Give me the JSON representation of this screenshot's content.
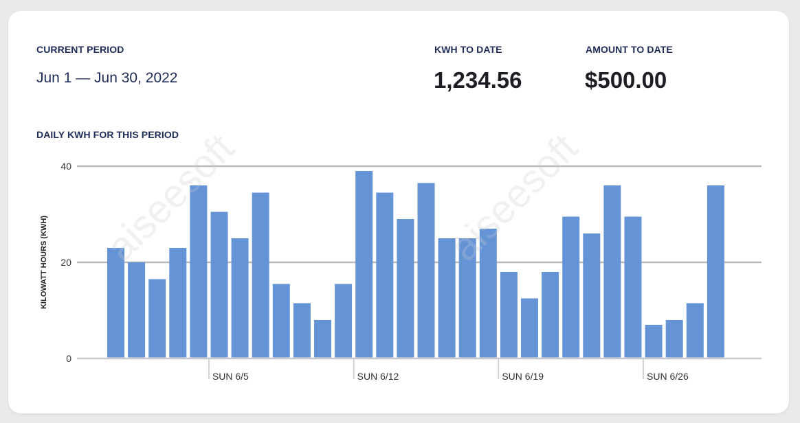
{
  "summary": {
    "period_label": "CURRENT PERIOD",
    "period_value": "Jun 1 — Jun 30, 2022",
    "kwh_label": "KWH TO DATE",
    "kwh_value": "1,234.56",
    "amount_label": "AMOUNT TO DATE",
    "amount_value": "$500.00"
  },
  "watermark_text": "aiseesoft",
  "chart_data": {
    "type": "bar",
    "title": "DAILY KWH FOR THIS PERIOD",
    "xlabel": "",
    "ylabel": "KILOWATT HOURS (KWH)",
    "ylim": [
      0,
      40
    ],
    "yticks": [
      0,
      20,
      40
    ],
    "grid": true,
    "bar_color": "#6594d6",
    "x_tick_labels": [
      {
        "day": 5,
        "label": "SUN 6/5"
      },
      {
        "day": 12,
        "label": "SUN 6/12"
      },
      {
        "day": 19,
        "label": "SUN 6/19"
      },
      {
        "day": 26,
        "label": "SUN 6/26"
      }
    ],
    "days": [
      1,
      2,
      3,
      4,
      5,
      6,
      7,
      8,
      9,
      10,
      11,
      12,
      13,
      14,
      15,
      16,
      17,
      18,
      19,
      20,
      21,
      22,
      23,
      24,
      25,
      26,
      27,
      28,
      29,
      30
    ],
    "values": [
      23,
      20,
      16.5,
      23,
      36,
      30.5,
      25,
      34.5,
      15.5,
      11.5,
      8,
      15.5,
      39,
      34.5,
      29,
      36.5,
      25,
      25,
      27,
      18,
      12.5,
      18,
      29.5,
      26,
      36,
      29.5,
      7,
      8,
      11.5,
      36
    ]
  }
}
